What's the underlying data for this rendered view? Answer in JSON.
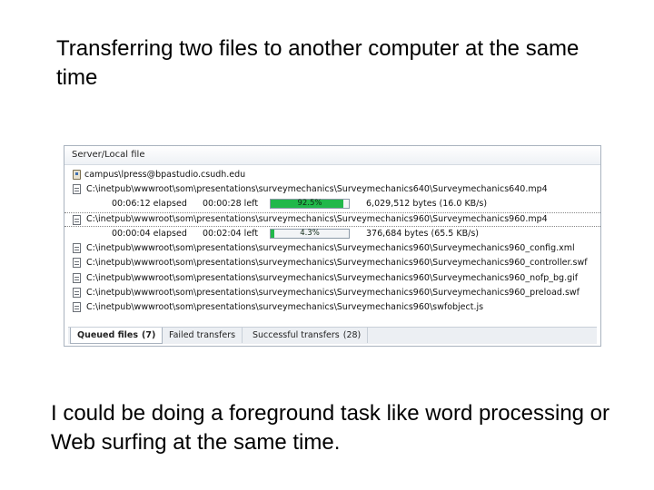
{
  "slide": {
    "title": "Transferring two files to another computer at the same time",
    "footer": "I could be doing a foreground task like word processing or Web surfing at the same time."
  },
  "window": {
    "column_header": "Server/Local file",
    "server": "campus\\lpress@bpastudio.csudh.edu",
    "transfers": [
      {
        "path": "C:\\inetpub\\wwwroot\\som\\presentations\\surveymechanics\\Surveymechanics640\\Surveymechanics640.mp4",
        "elapsed": "00:06:12 elapsed",
        "remaining": "00:00:28 left",
        "progress_label": "92.5%",
        "progress": 0.925,
        "bytes": "6,029,512 bytes (16.0 KB/s)"
      },
      {
        "path": "C:\\inetpub\\wwwroot\\som\\presentations\\surveymechanics\\Surveymechanics960\\Surveymechanics960.mp4",
        "elapsed": "00:00:04 elapsed",
        "remaining": "00:02:04 left",
        "progress_label": "4.3%",
        "progress": 0.043,
        "bytes": "376,684 bytes (65.5 KB/s)"
      }
    ],
    "queued": [
      "C:\\inetpub\\wwwroot\\som\\presentations\\surveymechanics\\Surveymechanics960\\Surveymechanics960_config.xml",
      "C:\\inetpub\\wwwroot\\som\\presentations\\surveymechanics\\Surveymechanics960\\Surveymechanics960_controller.swf",
      "C:\\inetpub\\wwwroot\\som\\presentations\\surveymechanics\\Surveymechanics960\\Surveymechanics960_nofp_bg.gif",
      "C:\\inetpub\\wwwroot\\som\\presentations\\surveymechanics\\Surveymechanics960\\Surveymechanics960_preload.swf",
      "C:\\inetpub\\wwwroot\\som\\presentations\\surveymechanics\\Surveymechanics960\\swfobject.js"
    ],
    "tabs": [
      {
        "label": "Queued files",
        "count": "(7)"
      },
      {
        "label": "Failed transfers",
        "count": ""
      },
      {
        "label": "Successful transfers",
        "count": "(28)"
      }
    ],
    "colors": {
      "progress_fill": "#21b84a",
      "border": "#a9b3bf"
    }
  }
}
